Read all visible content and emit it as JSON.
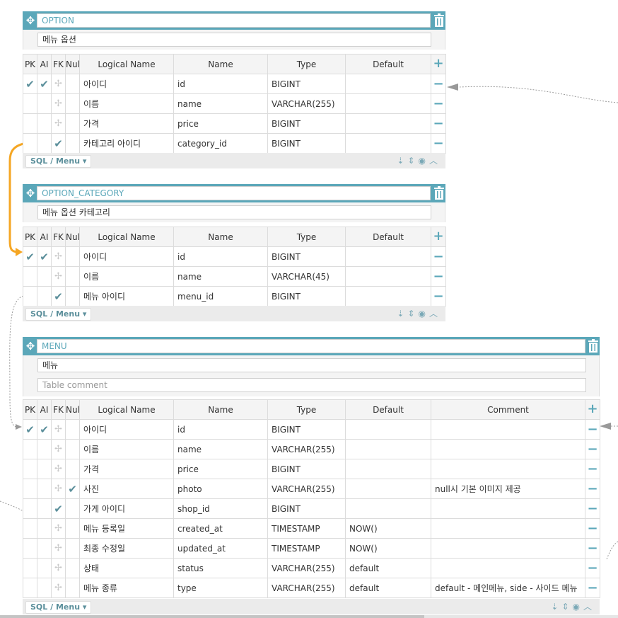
{
  "colors": {
    "accent": "#5ba7b9",
    "relation": "#f5a623",
    "check": "#5b8f9b"
  },
  "columns_header": {
    "pk": "PK",
    "ai": "AI",
    "fk": "FK",
    "null": "Null",
    "logical": "Logical Name",
    "name": "Name",
    "type": "Type",
    "default": "Default",
    "comment": "Comment"
  },
  "footer": {
    "sql_label": "SQL / Menu",
    "caret": "▾"
  },
  "icons": {
    "move": "move-icon",
    "trash": "trash-icon",
    "add": "plus-icon",
    "remove": "minus-icon",
    "sort": "sort-az-icon",
    "order": "updown-icon",
    "comment": "comment-icon",
    "collapse": "chevron-up-icon"
  },
  "option": {
    "name": "OPTION",
    "comment": "메뉴 옵션",
    "rows": [
      {
        "pk": true,
        "ai": true,
        "fk": false,
        "null": false,
        "logical": "아이디",
        "name": "id",
        "type": "BIGINT",
        "default": ""
      },
      {
        "pk": false,
        "ai": false,
        "fk": false,
        "null": false,
        "logical": "이름",
        "name": "name",
        "type": "VARCHAR(255)",
        "default": ""
      },
      {
        "pk": false,
        "ai": false,
        "fk": false,
        "null": false,
        "logical": "가격",
        "name": "price",
        "type": "BIGINT",
        "default": ""
      },
      {
        "pk": false,
        "ai": false,
        "fk": true,
        "null": false,
        "logical": "카테고리 아이디",
        "name": "category_id",
        "type": "BIGINT",
        "default": ""
      }
    ]
  },
  "option_category": {
    "name": "OPTION_CATEGORY",
    "comment": "메뉴 옵션 카테고리",
    "rows": [
      {
        "pk": true,
        "ai": true,
        "fk": false,
        "null": false,
        "logical": "아이디",
        "name": "id",
        "type": "BIGINT",
        "default": ""
      },
      {
        "pk": false,
        "ai": false,
        "fk": false,
        "null": false,
        "logical": "이름",
        "name": "name",
        "type": "VARCHAR(45)",
        "default": ""
      },
      {
        "pk": false,
        "ai": false,
        "fk": true,
        "null": false,
        "logical": "메뉴 아이디",
        "name": "menu_id",
        "type": "BIGINT",
        "default": ""
      }
    ]
  },
  "menu": {
    "name": "MENU",
    "comment": "메뉴",
    "table_comment_placeholder": "Table comment",
    "rows": [
      {
        "pk": true,
        "ai": true,
        "fk": false,
        "null": false,
        "logical": "아이디",
        "name": "id",
        "type": "BIGINT",
        "default": "",
        "comment": ""
      },
      {
        "pk": false,
        "ai": false,
        "fk": false,
        "null": false,
        "logical": "이름",
        "name": "name",
        "type": "VARCHAR(255)",
        "default": "",
        "comment": ""
      },
      {
        "pk": false,
        "ai": false,
        "fk": false,
        "null": false,
        "logical": "가격",
        "name": "price",
        "type": "BIGINT",
        "default": "",
        "comment": ""
      },
      {
        "pk": false,
        "ai": false,
        "fk": false,
        "null": true,
        "logical": "사진",
        "name": "photo",
        "type": "VARCHAR(255)",
        "default": "",
        "comment": "null시 기본 이미지 제공"
      },
      {
        "pk": false,
        "ai": false,
        "fk": true,
        "null": false,
        "logical": "가게 아이디",
        "name": "shop_id",
        "type": "BIGINT",
        "default": "",
        "comment": ""
      },
      {
        "pk": false,
        "ai": false,
        "fk": false,
        "null": false,
        "logical": "메뉴 등록일",
        "name": "created_at",
        "type": "TIMESTAMP",
        "default": "NOW()",
        "comment": ""
      },
      {
        "pk": false,
        "ai": false,
        "fk": false,
        "null": false,
        "logical": "최종 수정일",
        "name": "updated_at",
        "type": "TIMESTAMP",
        "default": "NOW()",
        "comment": ""
      },
      {
        "pk": false,
        "ai": false,
        "fk": false,
        "null": false,
        "logical": "상태",
        "name": "status",
        "type": "VARCHAR(255)",
        "default": "default",
        "comment": ""
      },
      {
        "pk": false,
        "ai": false,
        "fk": false,
        "null": false,
        "logical": "메뉴 종류",
        "name": "type",
        "type": "VARCHAR(255)",
        "default": "default",
        "comment": "default - 메인메뉴, side - 사이드 메뉴"
      }
    ]
  }
}
